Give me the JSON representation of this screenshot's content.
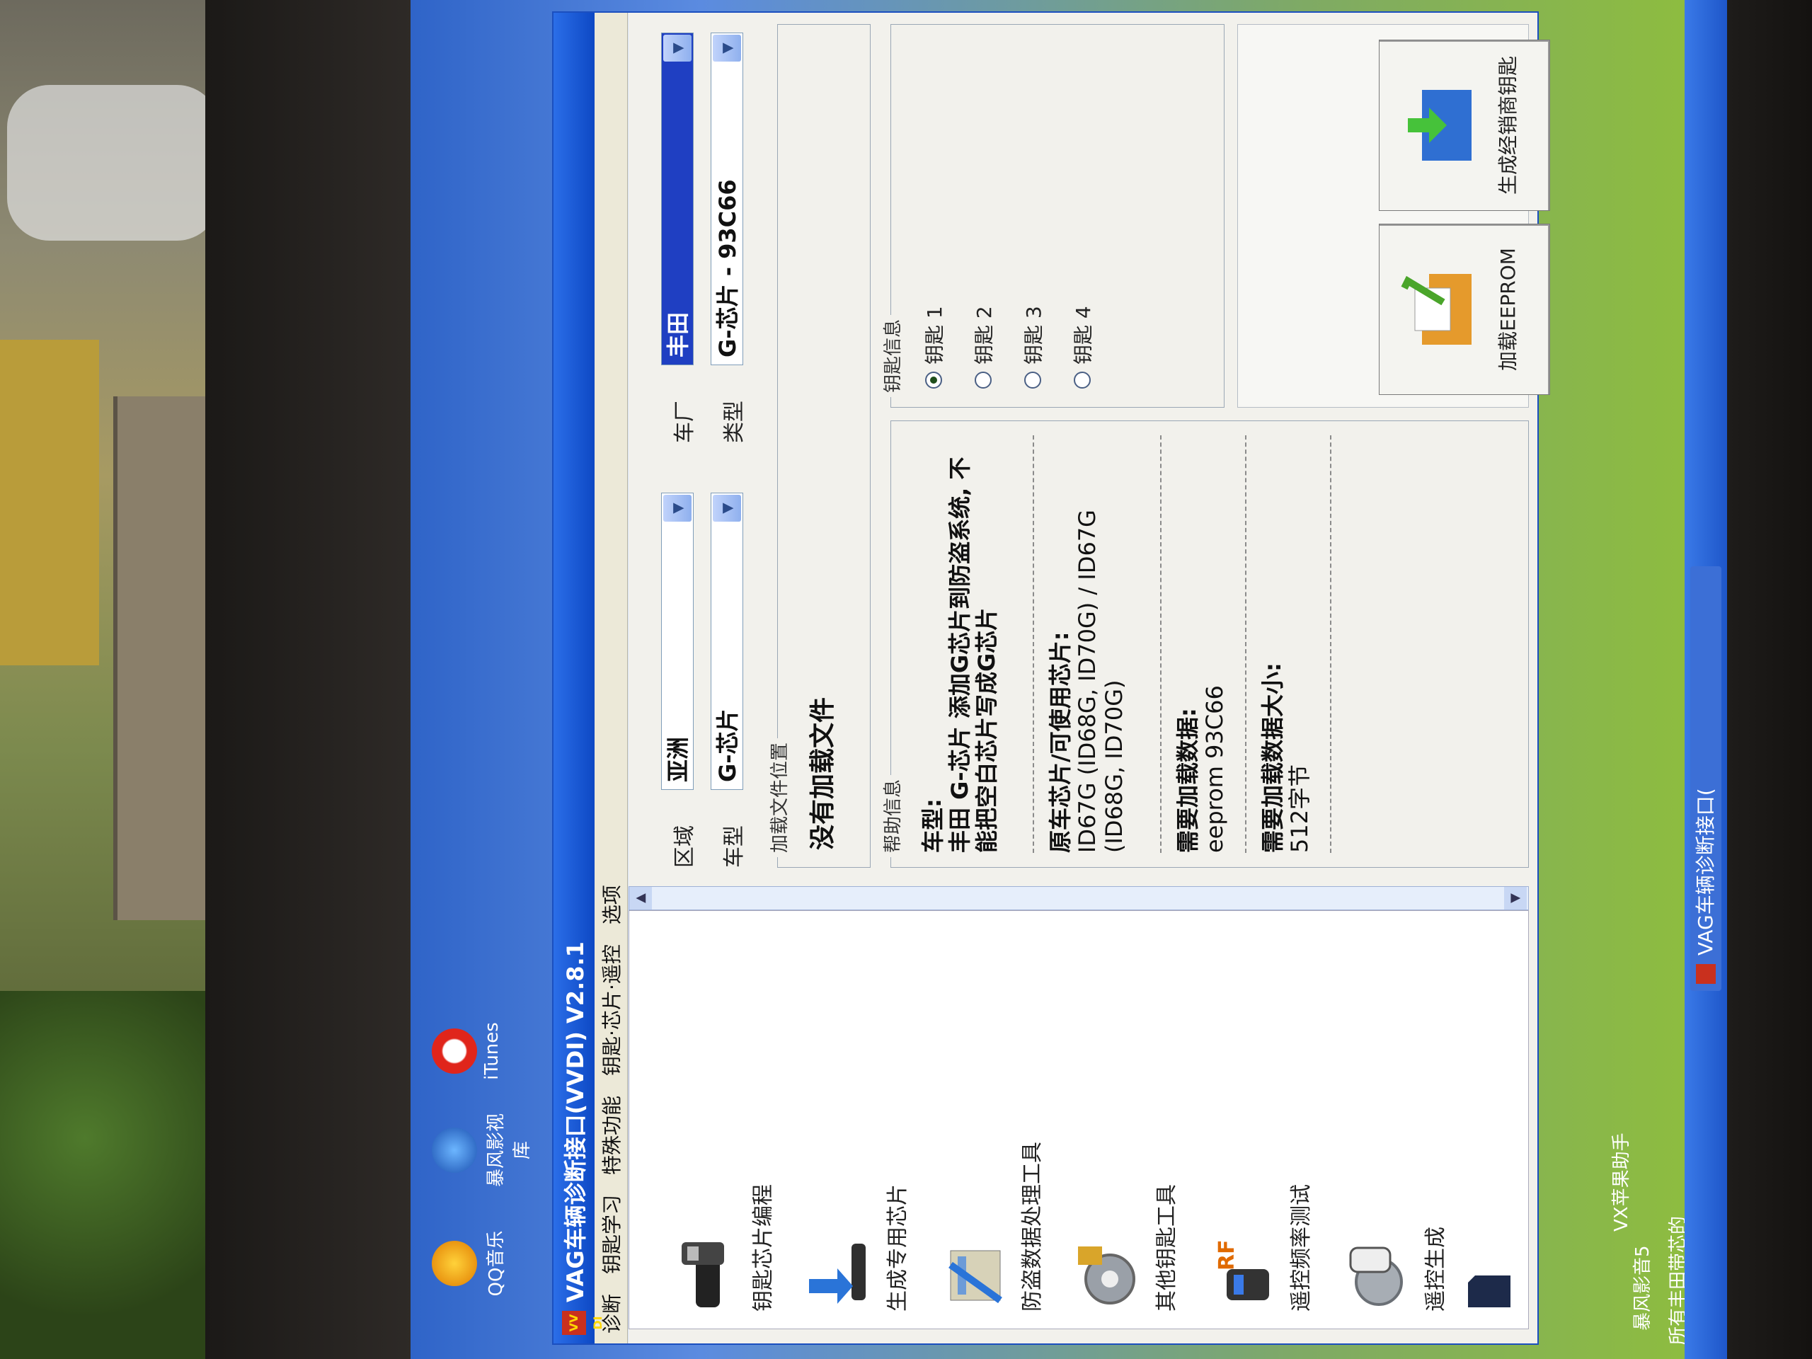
{
  "desktop": {
    "icons": [
      {
        "label": "QQ音乐"
      },
      {
        "label": "暴风影视库"
      },
      {
        "label": "iTunes"
      }
    ],
    "bottom_labels": [
      "VX苹果助手",
      "暴风影音5",
      "所有丰田带芯的"
    ]
  },
  "window": {
    "logo": "VV DI",
    "title": "VAG车辆诊断接口(VVDI)  V2.8.1",
    "menu": [
      "诊断",
      "钥匙学习",
      "特殊功能",
      "钥匙·芯片·遥控",
      "选项"
    ]
  },
  "nav": {
    "items": [
      {
        "label": "钥匙芯片编程"
      },
      {
        "label": "生成专用芯片"
      },
      {
        "label": "防盗数据处理工具"
      },
      {
        "label": "其他钥匙工具"
      },
      {
        "label": "遥控频率测试"
      },
      {
        "label": "遥控生成"
      }
    ]
  },
  "selectors": {
    "region_label": "区域",
    "region_value": "亚洲",
    "maker_label": "车厂",
    "maker_value": "丰田",
    "model_label": "车型",
    "model_value": "G-芯片",
    "type_label": "类型",
    "type_value": "G-芯片 - 93C66"
  },
  "file": {
    "legend": "加载文件位置",
    "value": "没有加载文件"
  },
  "help": {
    "legend": "帮助信息",
    "model_heading": "车型:",
    "model_text": "丰田 G-芯片 添加G芯片到防盗系统, 不能把空白芯片写成G芯片",
    "chips_heading": "原车芯片/可使用芯片:",
    "chips_text": "ID67G (ID68G, ID70G) / ID67G (ID68G, ID70G)",
    "eeprom_heading": "需要加载数据:",
    "eeprom_text": "eeprom 93C66",
    "size_heading": "需要加载数据大小:",
    "size_text": "512字节"
  },
  "keys": {
    "legend": "钥匙信息",
    "options": [
      "钥匙 1",
      "钥匙 2",
      "钥匙 3",
      "钥匙 4"
    ],
    "selected_index": 0
  },
  "actions": {
    "load_eeprom": "加载EEPROM",
    "generate_dealer_key": "生成经销商钥匙"
  },
  "taskbar": {
    "task_label": "VAG车辆诊断接口("
  }
}
